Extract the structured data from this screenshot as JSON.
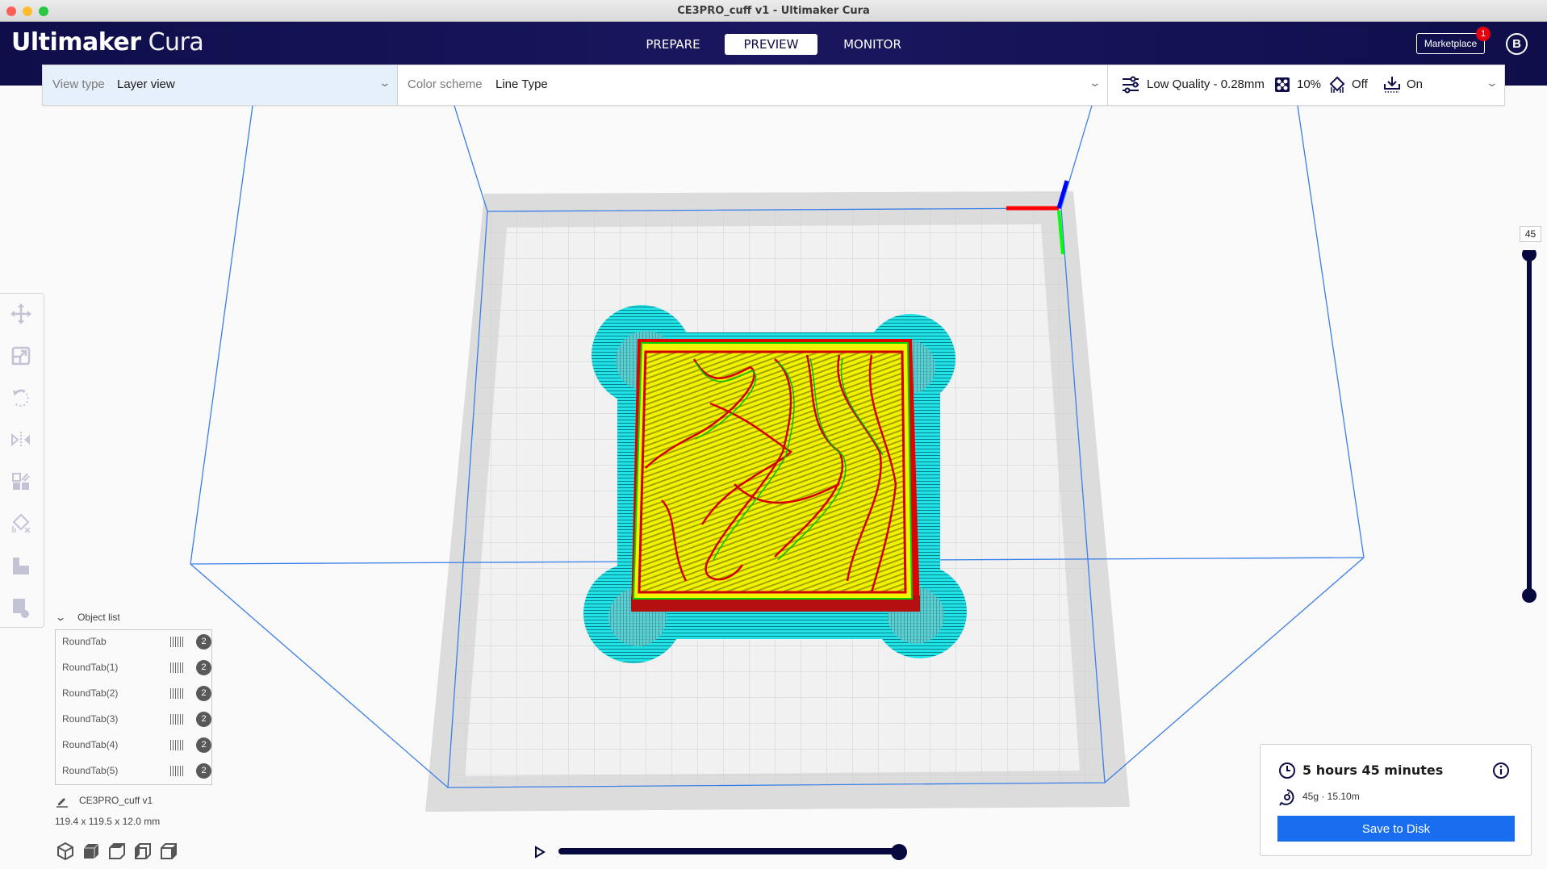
{
  "window": {
    "title": "CE3PRO_cuff v1 - Ultimaker Cura",
    "traffic_lights": [
      "#ff5f57",
      "#febc2e",
      "#28c840"
    ]
  },
  "header": {
    "logo_bold": "Ultimaker",
    "logo_light": "Cura",
    "tabs": [
      {
        "label": "PREPARE",
        "active": false
      },
      {
        "label": "PREVIEW",
        "active": true
      },
      {
        "label": "MONITOR",
        "active": false
      }
    ],
    "marketplace_label": "Marketplace",
    "marketplace_badge": "1",
    "account_initial": "B"
  },
  "toolbar": {
    "view_type_label": "View type",
    "view_type_value": "Layer view",
    "color_scheme_label": "Color scheme",
    "color_scheme_value": "Line Type",
    "profile": "Low Quality - 0.28mm",
    "infill": "10%",
    "support": "Off",
    "adhesion": "On"
  },
  "tools": [
    "move-icon",
    "scale-icon",
    "rotate-icon",
    "mirror-icon",
    "per-model-settings-icon",
    "support-blocker-icon",
    "tab-icon",
    "tab-remove-icon"
  ],
  "object_list": {
    "header": "Object list",
    "items": [
      {
        "name": "RoundTab",
        "extruder": "2"
      },
      {
        "name": "RoundTab(1)",
        "extruder": "2"
      },
      {
        "name": "RoundTab(2)",
        "extruder": "2"
      },
      {
        "name": "RoundTab(3)",
        "extruder": "2"
      },
      {
        "name": "RoundTab(4)",
        "extruder": "2"
      },
      {
        "name": "RoundTab(5)",
        "extruder": "2"
      }
    ],
    "job_name": "CE3PRO_cuff v1",
    "dimensions": "119.4 x 119.5 x 12.0 mm"
  },
  "view_buttons": [
    "3d-view-icon",
    "front-view-icon",
    "top-view-icon",
    "left-view-icon",
    "right-view-icon"
  ],
  "layer_slider": {
    "current_layer": "45",
    "upper_fraction": 1.0,
    "lower_fraction": 0.0
  },
  "path_slider": {
    "progress_fraction": 1.0
  },
  "job_card": {
    "print_time": "5 hours 45 minutes",
    "material": "45g · 15.10m",
    "save_label": "Save to Disk"
  },
  "colors": {
    "header_navy": "#0f0e4a",
    "accent_blue": "#196ef0",
    "wireframe": "#3a7fe8",
    "skirt": "#1ee8e8",
    "top_skin": "#f2f200",
    "outer_wall": "#e60000",
    "inner_wall": "#00e600"
  }
}
